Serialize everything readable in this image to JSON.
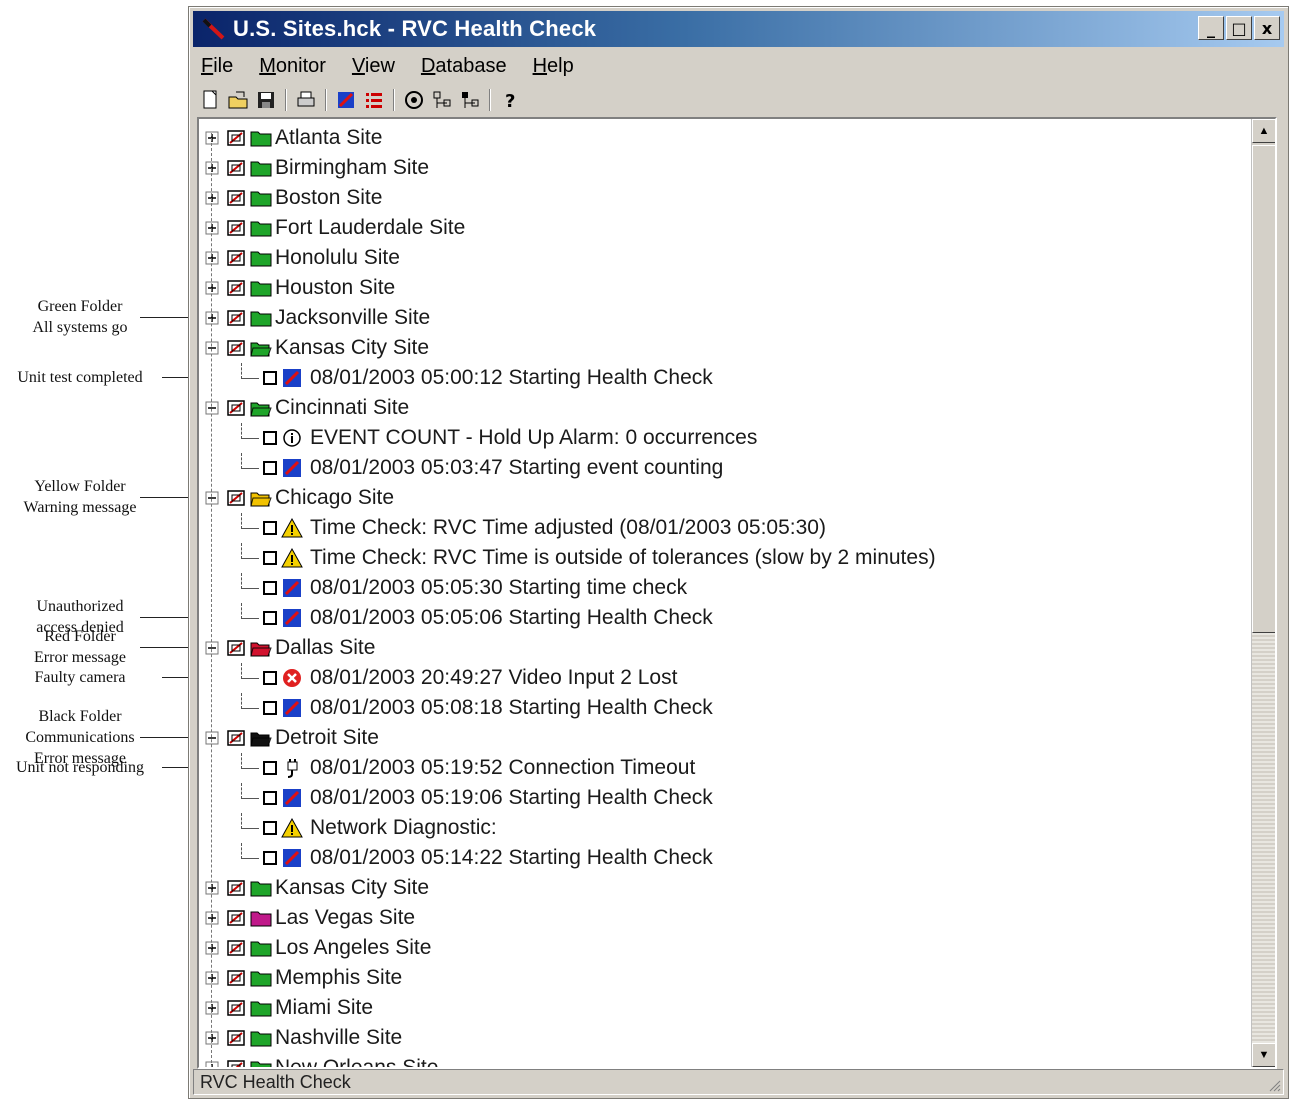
{
  "window": {
    "title": "U.S. Sites.hck - RVC Health Check",
    "min_label": "_",
    "max_label": "□",
    "close_label": "x"
  },
  "menu": [
    {
      "label": "File"
    },
    {
      "label": "Monitor"
    },
    {
      "label": "View"
    },
    {
      "label": "Database"
    },
    {
      "label": "Help"
    }
  ],
  "toolbar": [
    "new-icon",
    "open-icon",
    "save-icon",
    "print-icon",
    "health-check-icon",
    "list-icon",
    "options-icon",
    "tree-expand-icon",
    "tree-collapse-icon",
    "help-icon"
  ],
  "tree": {
    "sites": [
      {
        "label": "Atlanta Site",
        "status": "green"
      },
      {
        "label": "Birmingham Site",
        "status": "green"
      },
      {
        "label": "Boston Site",
        "status": "green"
      },
      {
        "label": "Fort Lauderdale Site",
        "status": "green"
      },
      {
        "label": "Honolulu Site",
        "status": "green"
      },
      {
        "label": "Houston Site",
        "status": "green"
      },
      {
        "label": "Jacksonville Site",
        "status": "green"
      },
      {
        "label": "Kansas City Site",
        "status": "green-open",
        "children": [
          {
            "icon": "check",
            "text": "08/01/2003 05:00:12 Starting Health Check"
          }
        ]
      },
      {
        "label": "Cincinnati Site",
        "status": "green-open",
        "children": [
          {
            "icon": "info",
            "text": "EVENT COUNT - Hold Up Alarm: 0 occurrences"
          },
          {
            "icon": "check",
            "text": "08/01/2003 05:03:47 Starting event counting"
          }
        ]
      },
      {
        "label": "Chicago Site",
        "status": "yellow",
        "children": [
          {
            "icon": "warning",
            "text": "Time Check: RVC Time adjusted (08/01/2003 05:05:30)"
          },
          {
            "icon": "warning",
            "text": "Time Check: RVC Time is outside of tolerances (slow by 2 minutes)"
          },
          {
            "icon": "check",
            "text": "08/01/2003 05:05:30 Starting time check"
          },
          {
            "icon": "check",
            "text": "08/01/2003 05:05:06 Starting Health Check"
          }
        ]
      },
      {
        "label": "Dallas Site",
        "status": "red",
        "children": [
          {
            "icon": "error",
            "text": "08/01/2003 20:49:27 Video Input 2 Lost"
          },
          {
            "icon": "check",
            "text": "08/01/2003 05:08:18 Starting Health Check"
          }
        ]
      },
      {
        "label": "Detroit Site",
        "status": "black",
        "children": [
          {
            "icon": "plug",
            "text": "08/01/2003 05:19:52 Connection Timeout"
          },
          {
            "icon": "check",
            "text": "08/01/2003 05:19:06 Starting Health Check"
          },
          {
            "icon": "warning",
            "text": "Network Diagnostic:"
          },
          {
            "icon": "check",
            "text": "08/01/2003 05:14:22 Starting Health Check"
          }
        ]
      },
      {
        "label": "Kansas City Site",
        "status": "green"
      },
      {
        "label": "Las Vegas Site",
        "status": "magenta"
      },
      {
        "label": "Los Angeles Site",
        "status": "green"
      },
      {
        "label": "Memphis Site",
        "status": "green"
      },
      {
        "label": "Miami Site",
        "status": "green"
      },
      {
        "label": "Nashville Site",
        "status": "green"
      },
      {
        "label": "New Orleans Site",
        "status": "green"
      }
    ]
  },
  "annotations": [
    {
      "text": "Green Folder\nAll systems go"
    },
    {
      "text": "Unit test completed"
    },
    {
      "text": "Yellow Folder\nWarning message"
    },
    {
      "text": "Unauthorized\naccess denied"
    },
    {
      "text": "Red Folder\nError message"
    },
    {
      "text": "Faulty camera"
    },
    {
      "text": "Black Folder\nCommunications\nError message"
    },
    {
      "text": "Unit not responding"
    }
  ],
  "status_bar": "RVC Health Check",
  "colors": {
    "folder_green": "#1fa52a",
    "folder_yellow": "#f2c200",
    "folder_red": "#d2122e",
    "folder_black": "#111111",
    "folder_magenta": "#c0198a",
    "title_start": "#0a246a",
    "title_end": "#a6caf0"
  }
}
